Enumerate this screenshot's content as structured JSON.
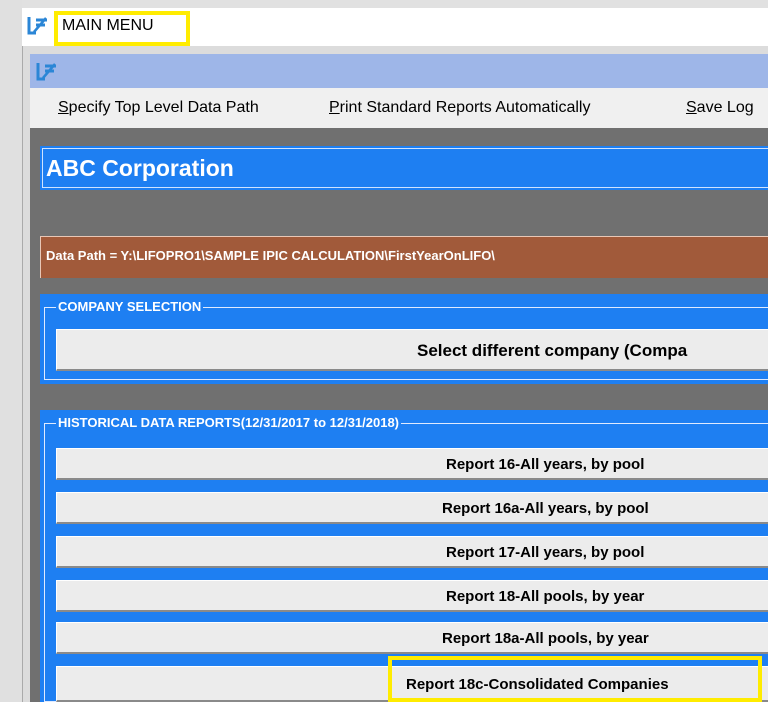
{
  "window": {
    "title": "MAIN MENU",
    "logo_icon": "lifopro-logo-icon",
    "highlight_color": "#ffec00"
  },
  "menu": {
    "items": [
      "Specify Top Level Data Path",
      "Print Standard Reports Automatically",
      "Save Log"
    ]
  },
  "company": {
    "name": "ABC Corporation"
  },
  "data_path": {
    "text": "Data Path = Y:\\LIFOPRO1\\SAMPLE IPIC CALCULATION\\FirstYearOnLIFO\\"
  },
  "company_selection": {
    "label": "COMPANY SELECTION",
    "button": "Select different company (Compa"
  },
  "historical": {
    "label": "HISTORICAL DATA REPORTS(12/31/2017 to 12/31/2018)",
    "buttons": [
      "Report 16-All years, by pool",
      "Report 16a-All years, by pool",
      "Report 17-All years, by pool",
      "Report 18-All pools, by year",
      "Report 18a-All pools, by year",
      "Report 18c-Consolidated Companies"
    ]
  },
  "colors": {
    "blue_panel": "#1e7ff2",
    "path_bar": "#a15a3a",
    "dark_bg": "#707070"
  }
}
